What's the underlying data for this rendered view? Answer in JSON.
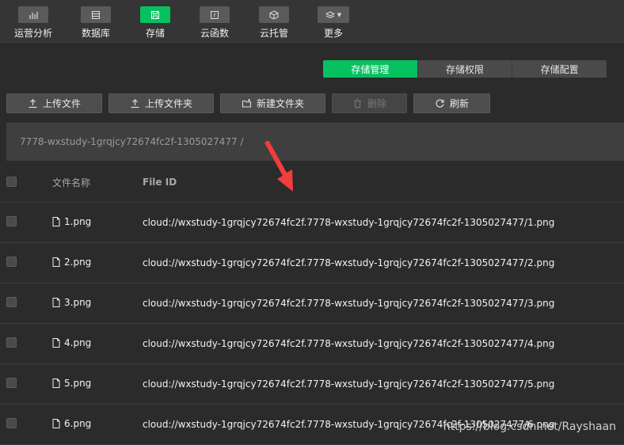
{
  "toolbar": {
    "items": [
      {
        "label": "运营分析",
        "icon": "bar-chart-icon"
      },
      {
        "label": "数据库",
        "icon": "database-icon"
      },
      {
        "label": "存储",
        "icon": "storage-icon"
      },
      {
        "label": "云函数",
        "icon": "function-icon"
      },
      {
        "label": "云托管",
        "icon": "cube-icon"
      },
      {
        "label": "更多",
        "icon": "layers-icon"
      }
    ],
    "active": "存储"
  },
  "tabs": [
    {
      "label": "存储管理",
      "active": true
    },
    {
      "label": "存储权限",
      "active": false
    },
    {
      "label": "存储配置",
      "active": false
    }
  ],
  "actions": {
    "upload_file": "上传文件",
    "upload_folder": "上传文件夹",
    "new_folder": "新建文件夹",
    "delete": "删除",
    "refresh": "刷新"
  },
  "path": "7778-wxstudy-1grqjcy72674fc2f-1305027477 /",
  "table": {
    "headers": {
      "name": "文件名称",
      "file_id": "File ID"
    },
    "rows": [
      {
        "name": "1.png",
        "file_id": "cloud://wxstudy-1grqjcy72674fc2f.7778-wxstudy-1grqjcy72674fc2f-1305027477/1.png"
      },
      {
        "name": "2.png",
        "file_id": "cloud://wxstudy-1grqjcy72674fc2f.7778-wxstudy-1grqjcy72674fc2f-1305027477/2.png"
      },
      {
        "name": "3.png",
        "file_id": "cloud://wxstudy-1grqjcy72674fc2f.7778-wxstudy-1grqjcy72674fc2f-1305027477/3.png"
      },
      {
        "name": "4.png",
        "file_id": "cloud://wxstudy-1grqjcy72674fc2f.7778-wxstudy-1grqjcy72674fc2f-1305027477/4.png"
      },
      {
        "name": "5.png",
        "file_id": "cloud://wxstudy-1grqjcy72674fc2f.7778-wxstudy-1grqjcy72674fc2f-1305027477/5.png"
      },
      {
        "name": "6.png",
        "file_id": "cloud://wxstudy-1grqjcy72674fc2f.7778-wxstudy-1grqjcy72674fc2f-1305027477/6.png"
      }
    ]
  },
  "watermark": "https://blog.csdn.net/Rayshaan",
  "colors": {
    "accent": "#07c160",
    "arrow": "#f23d3d"
  }
}
